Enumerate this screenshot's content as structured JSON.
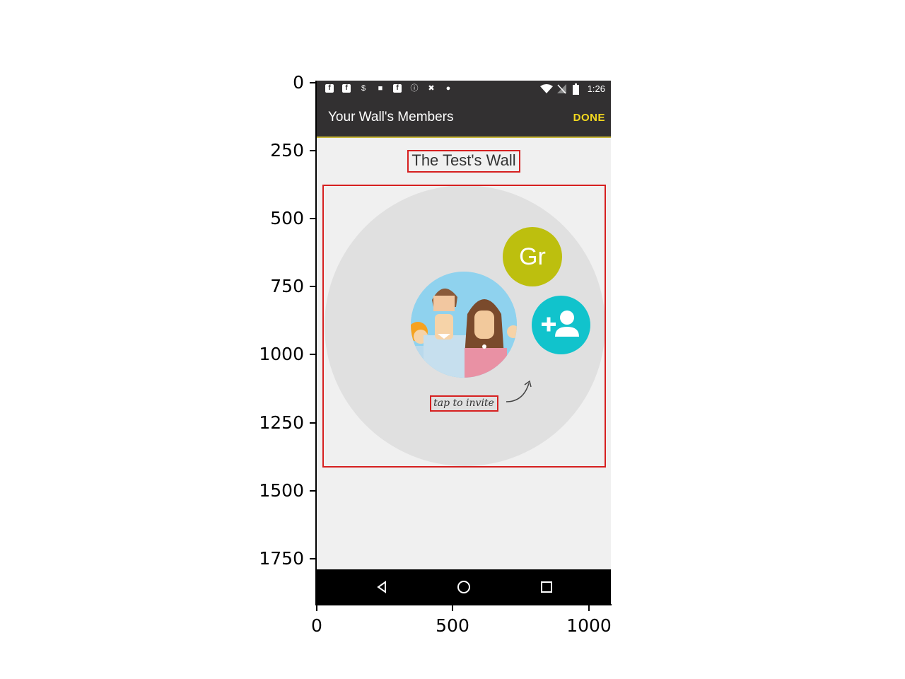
{
  "axes": {
    "y_ticks": [
      "0",
      "250",
      "500",
      "750",
      "1000",
      "1250",
      "1500",
      "1750"
    ],
    "x_ticks": [
      "0",
      "500",
      "1000"
    ]
  },
  "status_bar": {
    "time": "1:26"
  },
  "app_bar": {
    "title": "Your Wall's Members",
    "done_label": "DONE"
  },
  "wall": {
    "name": "The Test's Wall"
  },
  "members": [
    {
      "initials": "Gr",
      "color": "#bdbf0e"
    }
  ],
  "invite": {
    "hint": "tap to invite",
    "button_color": "#11c3cc"
  },
  "colors": {
    "app_bar": "#323031",
    "accent": "#f4d91f",
    "highlight_box": "#d62020"
  }
}
